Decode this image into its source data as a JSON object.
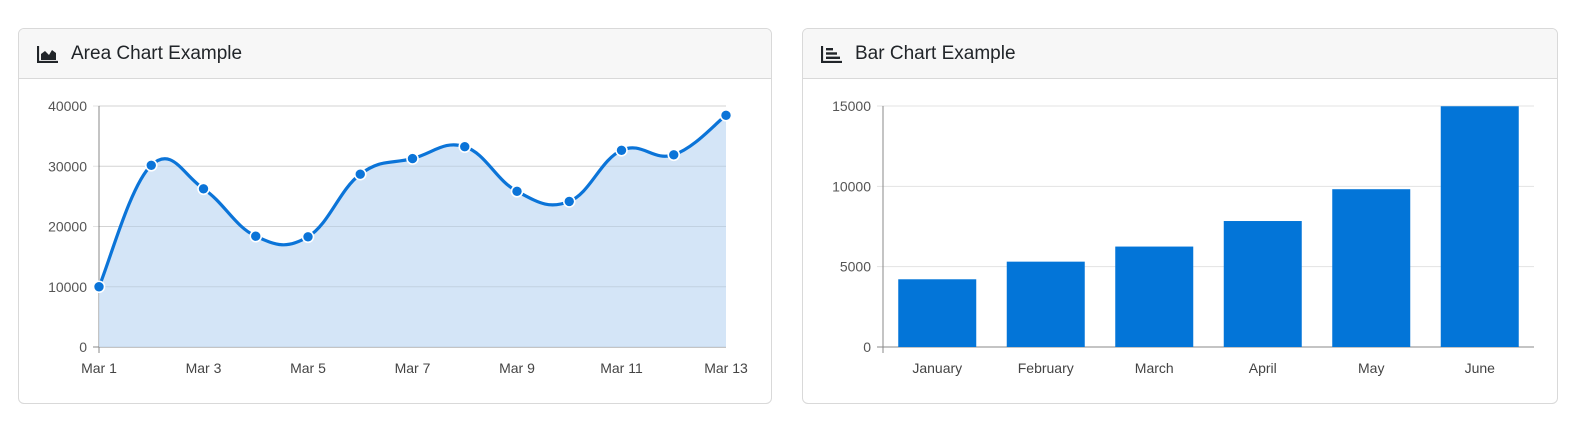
{
  "cards": [
    {
      "title": "Area Chart Example",
      "icon": "area-chart-icon"
    },
    {
      "title": "Bar Chart Example",
      "icon": "bar-chart-icon"
    }
  ],
  "colors": {
    "line": "#0b74d8",
    "area_fill": "#cce1f6",
    "bar": "#0375d8",
    "grid": "#e3e3e3",
    "axis": "#888888"
  },
  "chart_data": [
    {
      "type": "area",
      "title": "",
      "xlabel": "",
      "ylabel": "",
      "x": [
        "Mar 1",
        "Mar 2",
        "Mar 3",
        "Mar 4",
        "Mar 5",
        "Mar 6",
        "Mar 7",
        "Mar 8",
        "Mar 9",
        "Mar 10",
        "Mar 11",
        "Mar 12",
        "Mar 13"
      ],
      "x_tick_labels": [
        "Mar 1",
        "Mar 3",
        "Mar 5",
        "Mar 7",
        "Mar 9",
        "Mar 11",
        "Mar 13"
      ],
      "values": [
        10000,
        30160,
        26260,
        18390,
        18290,
        28680,
        31270,
        33250,
        25840,
        24160,
        32650,
        31900,
        38450
      ],
      "ylim": [
        0,
        40000
      ],
      "y_ticks": [
        0,
        10000,
        20000,
        30000,
        40000
      ],
      "grid": true
    },
    {
      "type": "bar",
      "title": "",
      "xlabel": "",
      "ylabel": "",
      "categories": [
        "January",
        "February",
        "March",
        "April",
        "May",
        "June"
      ],
      "values": [
        4215,
        5312,
        6251,
        7841,
        9821,
        14984
      ],
      "ylim": [
        0,
        15000
      ],
      "y_ticks": [
        0,
        5000,
        10000,
        15000
      ],
      "grid": true
    }
  ]
}
